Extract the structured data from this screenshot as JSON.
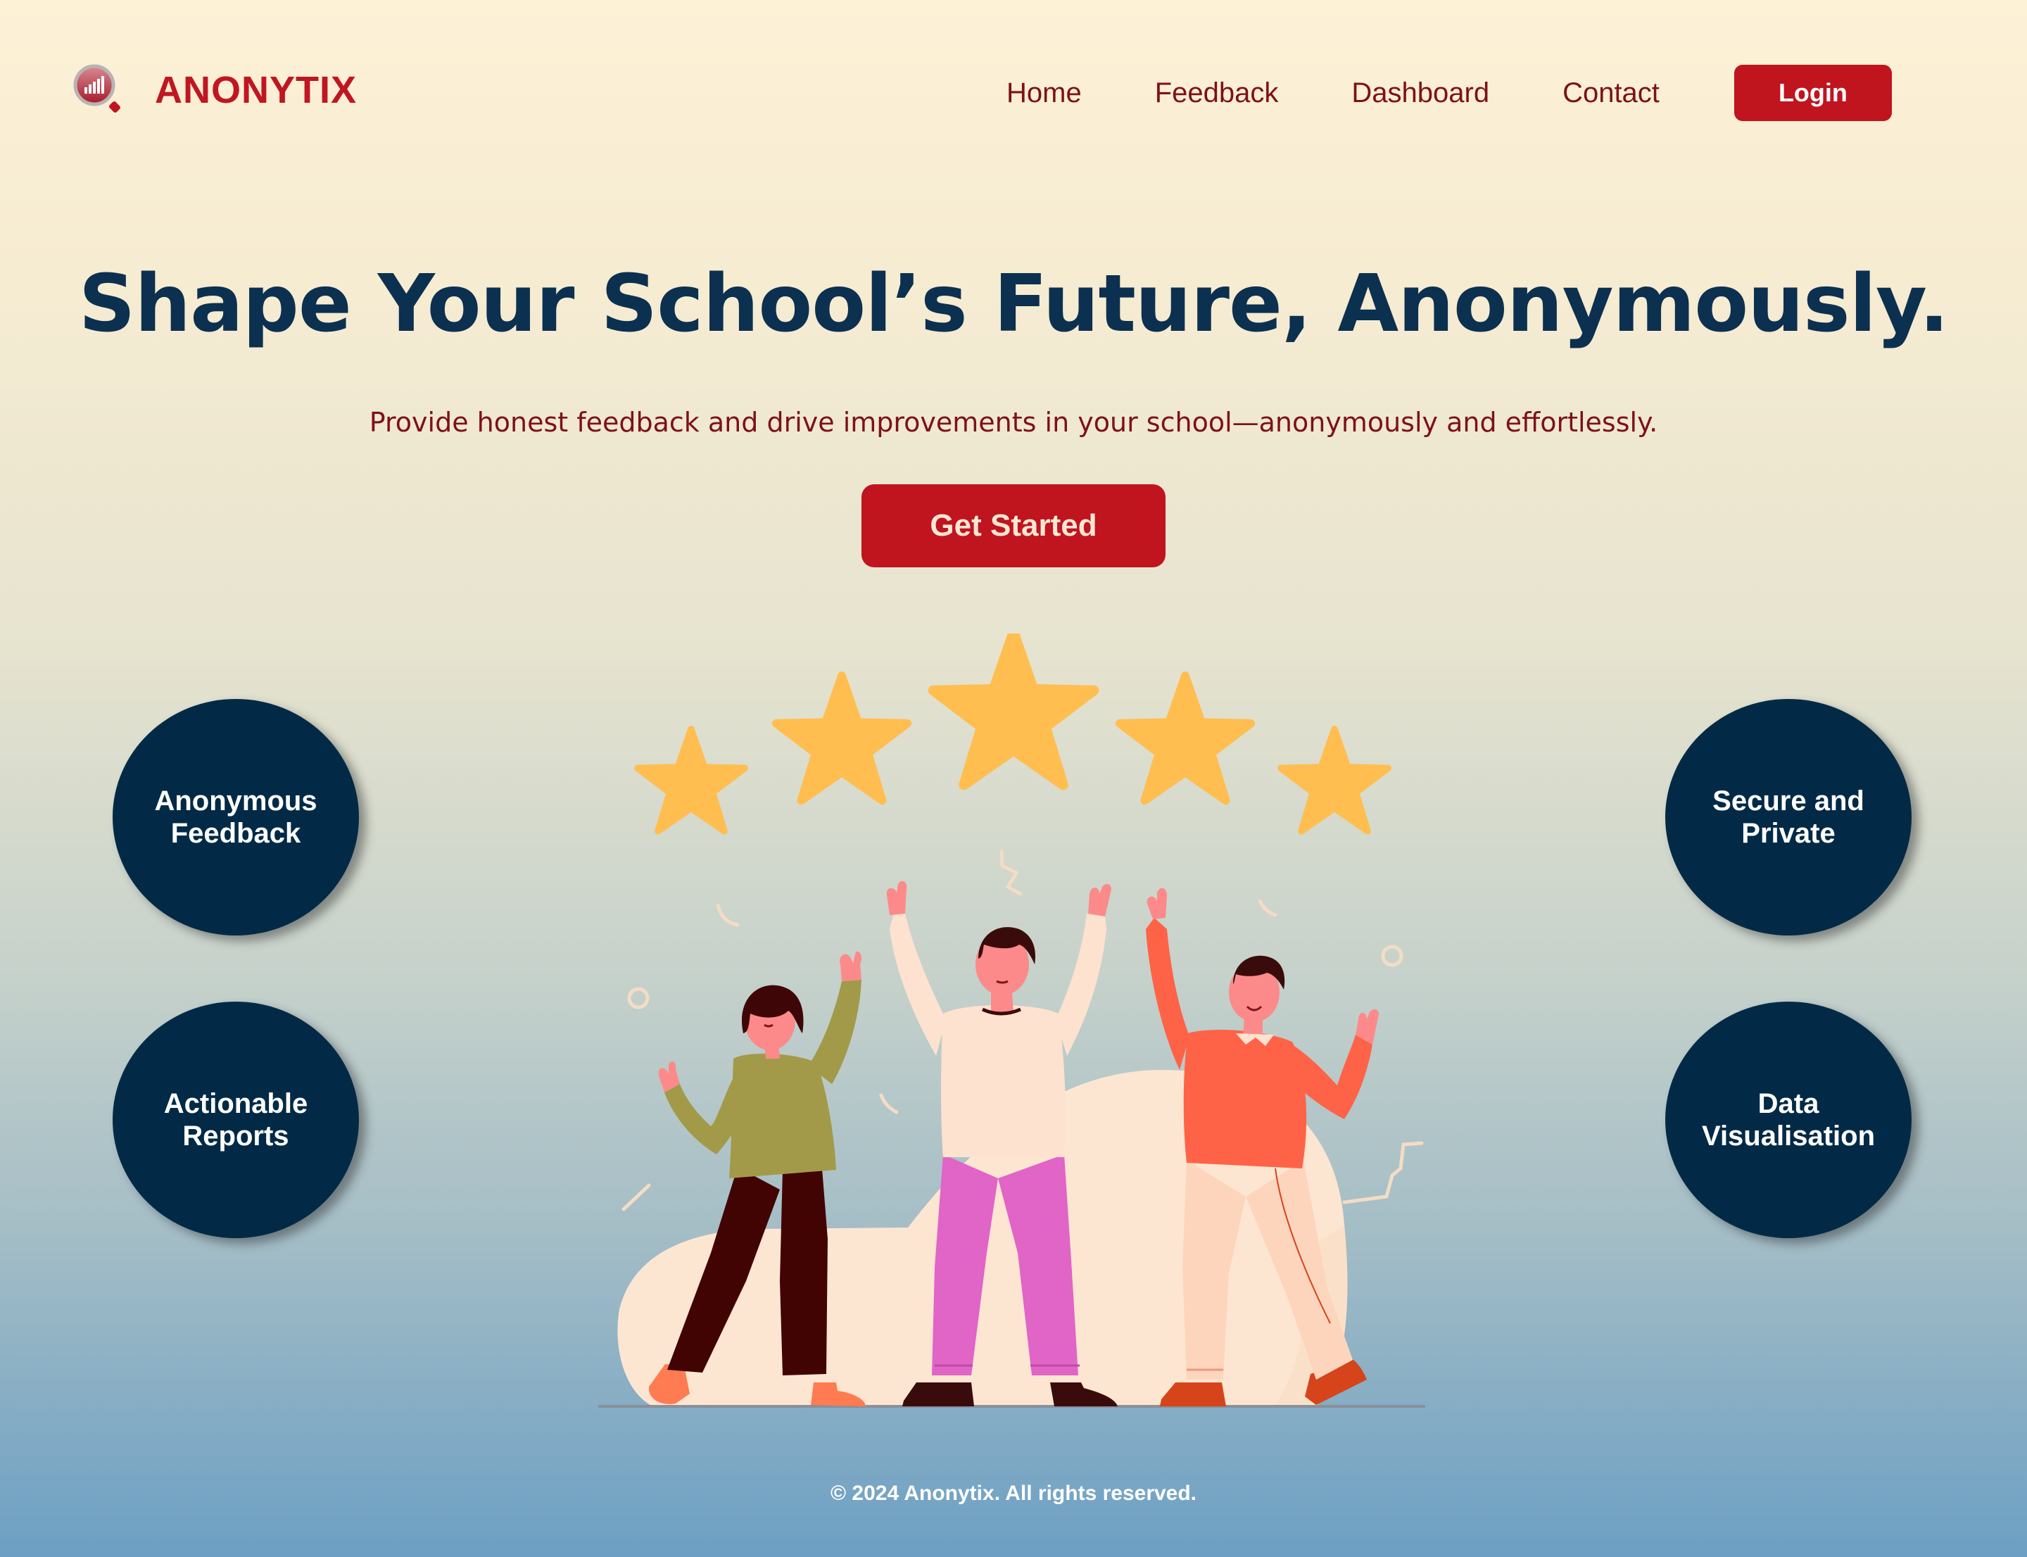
{
  "brand": {
    "name": "ANONYTIX",
    "logo_icon": "magnifier-chart-icon",
    "color": "#c01622"
  },
  "nav": {
    "links": [
      "Home",
      "Feedback",
      "Dashboard",
      "Contact"
    ],
    "login_label": "Login"
  },
  "hero": {
    "title": "Shape Your School’s Future, Anonymously.",
    "subtitle": "Provide honest feedback and drive improvements in your school—anonymously and effortlessly.",
    "cta_label": "Get Started"
  },
  "features": {
    "left": [
      "Anonymous Feedback",
      "Actionable Reports"
    ],
    "right": [
      "Secure and Private",
      "Data Visualisation"
    ]
  },
  "illustration": {
    "icon": "five-star-celebration-illustration",
    "stars": 5
  },
  "footer": {
    "copyright": "© 2024 Anonytix. All rights reserved."
  },
  "colors": {
    "accent": "#c0141f",
    "navy": "#022a46",
    "nav_text": "#7d1119",
    "star": "#ffbe4f"
  }
}
